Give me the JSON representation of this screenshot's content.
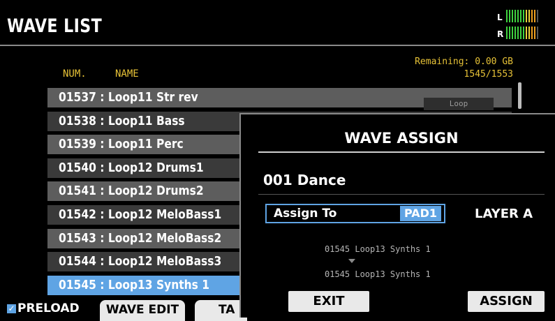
{
  "header": {
    "title": "WAVE LIST",
    "meter_left_label": "L",
    "meter_right_label": "R"
  },
  "list": {
    "num_header": "NUM.",
    "name_header": "NAME",
    "remaining_line1": "Remaining: 0.00 GB",
    "remaining_line2": "1545/1553",
    "loop_tag": "Loop",
    "rows": [
      {
        "text": "01537 : Loop11 Str rev",
        "selected": false
      },
      {
        "text": "01538 : Loop11 Bass",
        "selected": false
      },
      {
        "text": "01539 : Loop11 Perc",
        "selected": false
      },
      {
        "text": "01540 : Loop12 Drums1",
        "selected": false
      },
      {
        "text": "01541 : Loop12 Drums2",
        "selected": false
      },
      {
        "text": "01542 : Loop12 MeloBass1",
        "selected": false
      },
      {
        "text": "01543 : Loop12 MeloBass2",
        "selected": false
      },
      {
        "text": "01544 : Loop12 MeloBass3",
        "selected": false
      },
      {
        "text": "01545 : Loop13 Synths 1",
        "selected": true
      }
    ]
  },
  "bottom": {
    "preload_label": "PRELOAD",
    "preload_checked": true,
    "wave_edit_label": "WAVE EDIT",
    "third_button_label": "TA"
  },
  "dialog": {
    "title": "WAVE ASSIGN",
    "kit_name": "001 Dance",
    "assign_to_label": "Assign To",
    "assign_to_value": "PAD1",
    "layer_label": "LAYER A",
    "wave_from": "01545 Loop13 Synths 1",
    "wave_to": "01545 Loop13 Synths 1",
    "exit_label": "EXIT",
    "assign_label": "ASSIGN"
  },
  "colors": {
    "accent": "#5fa4e4",
    "label_yellow": "#e7c237",
    "row_light": "#5d5d5d",
    "row_dark": "#3a3a3a"
  }
}
